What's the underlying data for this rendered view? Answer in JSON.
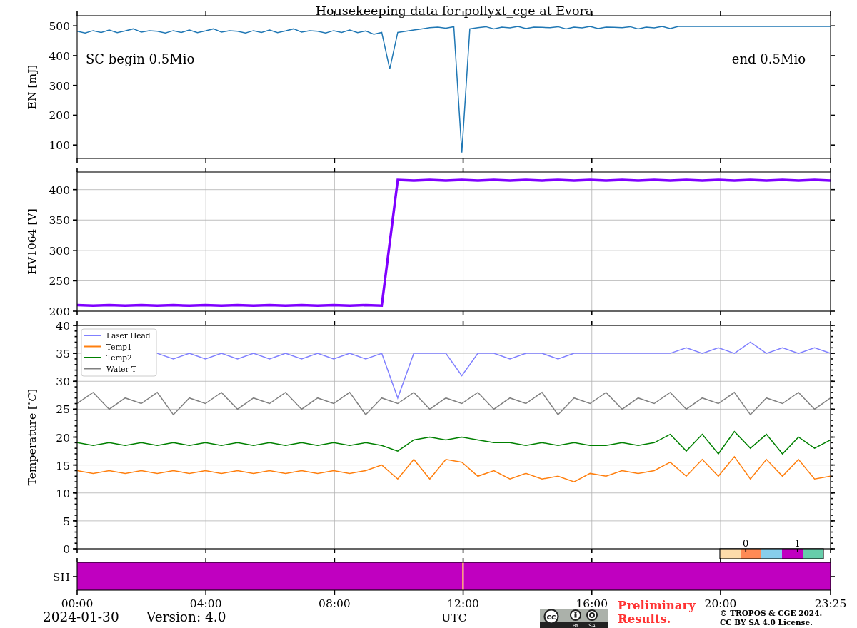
{
  "title": "Housekeeping data for pollyxt_cge at Evora",
  "panels": [
    {
      "chart_data": {
        "type": "line",
        "ylabel": "EN [mJ]",
        "ylim": [
          55,
          534
        ],
        "yticks": [
          {
            "value": 100,
            "label": "100"
          },
          {
            "value": 200,
            "label": "200"
          },
          {
            "value": 300,
            "label": "300"
          },
          {
            "value": 400,
            "label": "400"
          },
          {
            "value": 500,
            "label": "500"
          }
        ],
        "annotations": [
          "SC begin 0.5Mio",
          "end 0.5Mio"
        ],
        "categories": [
          null,
          null,
          null,
          null,
          null,
          null,
          null,
          null,
          null,
          null,
          null,
          null,
          null,
          null,
          null,
          null,
          null,
          null,
          null,
          null,
          null,
          null,
          null,
          null,
          null,
          null,
          null,
          null,
          null,
          null,
          null,
          null,
          null,
          null,
          null,
          null,
          null,
          null,
          null,
          null,
          null,
          null,
          null,
          null,
          null,
          null,
          null,
          null,
          null,
          null,
          null,
          null,
          null,
          null,
          null,
          null,
          null,
          null,
          null,
          null,
          null,
          null,
          null,
          null,
          null,
          null,
          null,
          null,
          null,
          null,
          null,
          null,
          null,
          null,
          null,
          null,
          null,
          null,
          null,
          null,
          null,
          null,
          null,
          null,
          null,
          null,
          null,
          null,
          null,
          null,
          null,
          null,
          null,
          null,
          null
        ],
        "series": [
          {
            "color": "#1f77b4",
            "values": [
              482,
              476,
              484,
              478,
              486,
              477,
              483,
              490,
              479,
              484,
              482,
              476,
              484,
              478,
              486,
              477,
              483,
              490,
              479,
              484,
              482,
              476,
              484,
              478,
              486,
              477,
              483,
              490,
              479,
              484,
              482,
              476,
              484,
              478,
              486,
              477,
              483,
              472,
              478,
              355,
              478,
              482,
              486,
              490,
              494,
              496,
              492,
              497,
              75,
              490,
              494,
              497,
              490,
              496,
              493,
              498,
              491,
              496,
              495,
              494,
              497,
              490,
              496,
              493,
              498,
              491,
              496,
              495,
              494,
              497,
              490,
              496,
              493,
              498,
              491,
              498,
              498,
              498,
              498,
              498,
              498,
              498,
              498,
              498,
              498,
              498,
              498,
              498,
              498,
              498,
              498,
              498,
              498,
              498,
              498
            ]
          }
        ]
      }
    },
    {
      "chart_data": {
        "type": "line",
        "grid": true,
        "ylabel": "HV1064 [V]",
        "ylim": [
          200,
          429
        ],
        "yticks": [
          {
            "value": 200,
            "label": "200"
          },
          {
            "value": 250,
            "label": "250"
          },
          {
            "value": 300,
            "label": "300"
          },
          {
            "value": 350,
            "label": "350"
          },
          {
            "value": 400,
            "label": "400"
          }
        ],
        "categories": [
          null,
          null,
          null,
          null,
          null,
          null,
          null,
          null,
          null,
          null,
          null,
          null,
          null,
          null,
          null,
          null,
          null,
          null,
          null,
          null,
          null,
          null,
          null,
          null,
          null,
          null,
          null,
          null,
          null,
          null,
          null,
          null,
          null,
          null,
          null,
          null,
          null,
          null,
          null,
          null,
          null,
          null,
          null,
          null,
          null,
          null,
          null,
          null
        ],
        "series": [
          {
            "color": "#7f00ff",
            "values": [
              210,
              209,
              210,
              209,
              210,
              209,
              210,
              209,
              210,
              209,
              210,
              209,
              210,
              209,
              210,
              209,
              210,
              209,
              210,
              209,
              416,
              415,
              416,
              415,
              416,
              415,
              416,
              415,
              416,
              415,
              416,
              415,
              416,
              415,
              416,
              415,
              416,
              415,
              416,
              415,
              416,
              415,
              416,
              415,
              416,
              415,
              416,
              415
            ]
          }
        ]
      }
    },
    {
      "chart_data": {
        "type": "line",
        "grid": true,
        "legend": "upper left",
        "ylabel": "Temperature [$^{∘}$*C*]",
        "ylim": [
          0,
          40
        ],
        "yticks": [
          {
            "value": 0,
            "label": "0"
          },
          {
            "value": 5,
            "label": "5"
          },
          {
            "value": 10,
            "label": "10"
          },
          {
            "value": 15,
            "label": "15"
          },
          {
            "value": 20,
            "label": "20"
          },
          {
            "value": 25,
            "label": "25"
          },
          {
            "value": 30,
            "label": "30"
          },
          {
            "value": 35,
            "label": "35"
          },
          {
            "value": 40,
            "label": "40"
          }
        ],
        "categories": [
          null,
          null,
          null,
          null,
          null,
          null,
          null,
          null,
          null,
          null,
          null,
          null,
          null,
          null,
          null,
          null,
          null,
          null,
          null,
          null,
          null,
          null,
          null,
          null,
          null,
          null,
          null,
          null,
          null,
          null,
          null,
          null,
          null,
          null,
          null,
          null,
          null,
          null,
          null,
          null,
          null,
          null,
          null,
          null,
          null,
          null,
          null,
          null
        ],
        "series": [
          {
            "name": "Laser Head",
            "color": "#8080ff",
            "values": [
              null,
              null,
              null,
              null,
              null,
              35,
              34,
              35,
              34,
              35,
              34,
              35,
              34,
              35,
              34,
              35,
              34,
              35,
              34,
              35,
              27,
              35,
              35,
              35,
              31,
              35,
              35,
              34,
              35,
              35,
              34,
              35,
              35,
              35,
              35,
              35,
              35,
              35,
              36,
              35,
              36,
              35,
              37,
              35,
              36,
              35,
              36,
              35
            ]
          },
          {
            "name": "Temp1",
            "color": "#ff7f0e",
            "values": [
              14,
              13.5,
              14,
              13.5,
              14,
              13.5,
              14,
              13.5,
              14,
              13.5,
              14,
              13.5,
              14,
              13.5,
              14,
              13.5,
              14,
              13.5,
              14,
              15,
              12.5,
              16,
              12.5,
              16,
              15.5,
              13,
              14,
              12.5,
              13.5,
              12.5,
              13,
              12,
              13.5,
              13,
              14,
              13.5,
              14,
              15.5,
              13,
              16,
              13,
              16.5,
              12.5,
              16,
              13,
              16,
              12.5,
              13
            ]
          },
          {
            "name": "Temp2",
            "color": "#008000",
            "values": [
              19,
              18.5,
              19,
              18.5,
              19,
              18.5,
              19,
              18.5,
              19,
              18.5,
              19,
              18.5,
              19,
              18.5,
              19,
              18.5,
              19,
              18.5,
              19,
              18.5,
              17.5,
              19.5,
              20,
              19.5,
              20,
              19.5,
              19,
              19,
              18.5,
              19,
              18.5,
              19,
              18.5,
              18.5,
              19,
              18.5,
              19,
              20.5,
              17.5,
              20.5,
              17,
              21,
              18,
              20.5,
              17,
              20,
              18,
              19.5
            ]
          },
          {
            "name": "Water T",
            "color": "#808080",
            "values": [
              26,
              28,
              25,
              27,
              26,
              28,
              24,
              27,
              26,
              28,
              25,
              27,
              26,
              28,
              25,
              27,
              26,
              28,
              24,
              27,
              26,
              28,
              25,
              27,
              26,
              28,
              25,
              27,
              26,
              28,
              24,
              27,
              26,
              28,
              25,
              27,
              26,
              28,
              25,
              27,
              26,
              28,
              24,
              27,
              26,
              28,
              25,
              27
            ]
          }
        ]
      }
    }
  ],
  "colorbar": {
    "ticks": [
      "0",
      "1"
    ],
    "swatches": [
      {
        "color": "#fddcaa"
      },
      {
        "color": "#ff8a55"
      },
      {
        "color": "#87ceeb"
      },
      {
        "color": "#c000c0"
      },
      {
        "color": "#66cdaa"
      }
    ]
  },
  "sh_panel": {
    "ylabel": "SH",
    "xlabel": "UTC",
    "xticks": [
      "00:00",
      "04:00",
      "08:00",
      "12:00",
      "16:00",
      "20:00",
      "23:25"
    ],
    "segments": [
      {
        "level": 0.5111,
        "color": "#c000c0"
      },
      {
        "level": 0.0022,
        "color": "#ff8a55"
      },
      {
        "level": 0.4867,
        "color": "#c000c0"
      }
    ]
  },
  "footer": {
    "date": "2024-01-30",
    "version": "Version: 4.0",
    "badge": {
      "symbol": "cc",
      "labels": [
        "BY",
        "SA"
      ]
    },
    "notice": [
      "Preliminary",
      "Results."
    ],
    "copyright": [
      "© TROPOS & CGE 2024.",
      "CC BY SA 4.0 License."
    ]
  }
}
